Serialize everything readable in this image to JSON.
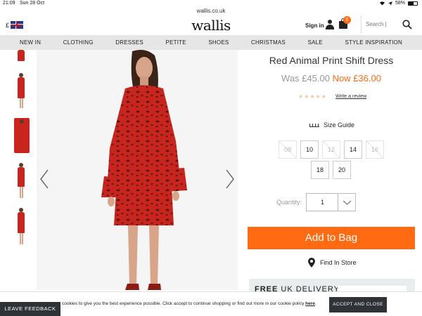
{
  "status_bar": {
    "time": "21:09",
    "date": "Sun 28 Oct",
    "battery": "58%",
    "battery_level": 0.58
  },
  "browser": {
    "url": "wallis.co.uk"
  },
  "header": {
    "currency": "£",
    "logo": "wallis",
    "signin_label": "Sign in",
    "bag_count": "0",
    "search_placeholder": "Search |"
  },
  "nav": {
    "items": [
      "NEW IN",
      "CLOTHING",
      "DRESSES",
      "PETITE",
      "SHOES",
      "CHRISTMAS",
      "SALE",
      "STYLE INSPIRATION"
    ]
  },
  "product": {
    "title": "Red Animal Print Shift Dress",
    "was_price": "Was £45.00",
    "now_price": "Now £36.00",
    "rating_stars": 0,
    "review_link": "Write a review",
    "size_guide_label": "Size Guide",
    "sizes": [
      {
        "label": "08",
        "available": false
      },
      {
        "label": "10",
        "available": true
      },
      {
        "label": "12",
        "available": false
      },
      {
        "label": "14",
        "available": true
      },
      {
        "label": "16",
        "available": false
      },
      {
        "label": "18",
        "available": true
      },
      {
        "label": "20",
        "available": true
      }
    ],
    "quantity_label": "Quantity:",
    "quantity_value": "1",
    "add_to_bag_label": "Add to Bag",
    "find_in_store_label": "Find In Store",
    "free_delivery_label": "FREE",
    "free_delivery_rest": " UK DELIVERY"
  },
  "cookie": {
    "message": "cookies to give you the best experience possible. Click accept to continue shopping or find out more in our cookie policy ",
    "link": "here",
    "end": ".",
    "accept_label": "ACCEPT AND CLOSE"
  },
  "feedback_label": "LEAVE FEEDBACK",
  "colors": {
    "accent": "#ff6a13",
    "dark": "#2e3338",
    "nav_bg": "#e6e6e6",
    "dress": "#c8251f"
  }
}
